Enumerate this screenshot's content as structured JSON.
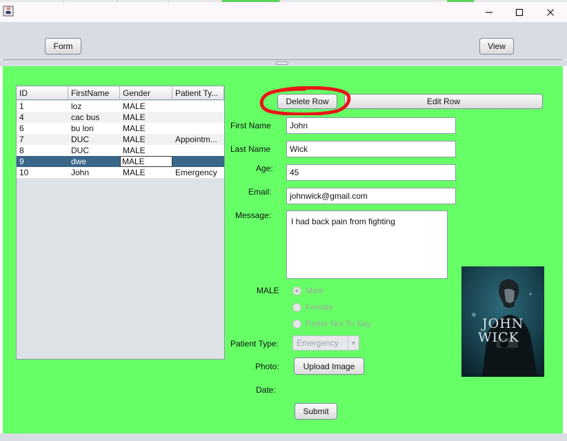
{
  "window": {
    "icon": "java-cup-icon",
    "controls": [
      "minimize-icon",
      "maximize-icon",
      "close-icon"
    ]
  },
  "toolbar": {
    "form_label": "Form",
    "view_label": "View"
  },
  "colors": {
    "panel_bg": "#66ff66",
    "selected_row": "#3a6688",
    "annotation": "#e8161a"
  },
  "table": {
    "columns": [
      "ID",
      "FirstName",
      "Gender",
      "Patient Ty..."
    ],
    "rows": [
      {
        "id": "1",
        "first": "loz",
        "gender": "MALE",
        "type": ""
      },
      {
        "id": "4",
        "first": "cac bus",
        "gender": "MALE",
        "type": ""
      },
      {
        "id": "6",
        "first": "bu lon",
        "gender": "MALE",
        "type": ""
      },
      {
        "id": "7",
        "first": "DUC",
        "gender": "MALE",
        "type": "Appointm..."
      },
      {
        "id": "8",
        "first": "DUC",
        "gender": "MALE",
        "type": ""
      },
      {
        "id": "9",
        "first": "dwe",
        "gender": "MALE",
        "type": ""
      },
      {
        "id": "10",
        "first": "John",
        "gender": "MALE",
        "type": "Emergency"
      }
    ],
    "selected_row_index": 5
  },
  "actions": {
    "delete_label": "Delete Row",
    "edit_label": "Edit Row"
  },
  "form": {
    "first_name_label": "First Name",
    "first_name_value": "John",
    "last_name_label": "Last Name",
    "last_name_value": "Wick",
    "age_label": "Age:",
    "age_value": "45",
    "email_label": "Email:",
    "email_value": "johnwick@gmail.com",
    "message_label": "Message:",
    "message_value": "I had back pain from fighting",
    "gender_label": "MALE",
    "gender_options": [
      "Male",
      "Female",
      "Prefer Not To Say"
    ],
    "gender_selected": "Male",
    "patient_type_label": "Patient Type:",
    "patient_type_value": "Emergency",
    "photo_label": "Photo:",
    "upload_label": "Upload Image",
    "date_label": "Date:",
    "submit_label": "Submit"
  },
  "poster": {
    "line1": "JOHN",
    "line2": "WICK"
  }
}
